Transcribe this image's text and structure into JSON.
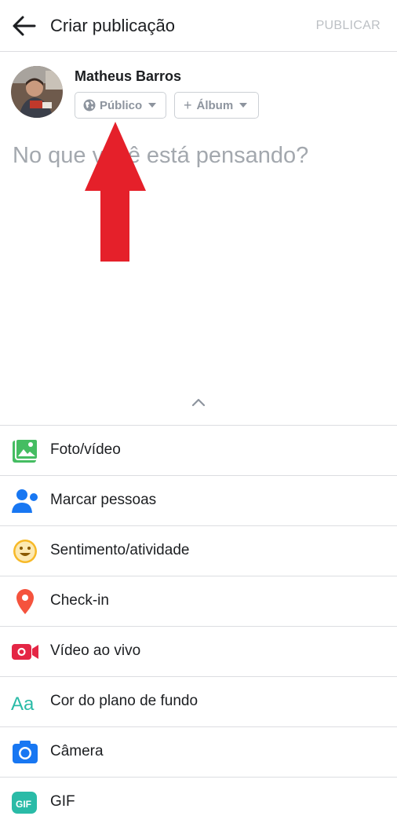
{
  "header": {
    "title": "Criar publicação",
    "publish_label": "PUBLICAR"
  },
  "user": {
    "name": "Matheus Barros"
  },
  "audience": {
    "label": "Público"
  },
  "album": {
    "label": "Álbum"
  },
  "composer": {
    "placeholder": "No que você está pensando?"
  },
  "actions": [
    {
      "label": "Foto/vídeo",
      "icon": "photo-video-icon",
      "color": "#45bd62"
    },
    {
      "label": "Marcar pessoas",
      "icon": "tag-people-icon",
      "color": "#1877f2"
    },
    {
      "label": "Sentimento/atividade",
      "icon": "feeling-icon",
      "color": "#f7b928"
    },
    {
      "label": "Check-in",
      "icon": "location-pin-icon",
      "color": "#f5533d"
    },
    {
      "label": "Vídeo ao vivo",
      "icon": "live-video-icon",
      "color": "#e42645"
    },
    {
      "label": "Cor do plano de fundo",
      "icon": "background-color-icon",
      "color": "#2abba7"
    },
    {
      "label": "Câmera",
      "icon": "camera-icon",
      "color": "#1877f2"
    },
    {
      "label": "GIF",
      "icon": "gif-icon",
      "color": "#2abba7"
    }
  ],
  "annotation": {
    "arrow_color": "#e5202a"
  }
}
